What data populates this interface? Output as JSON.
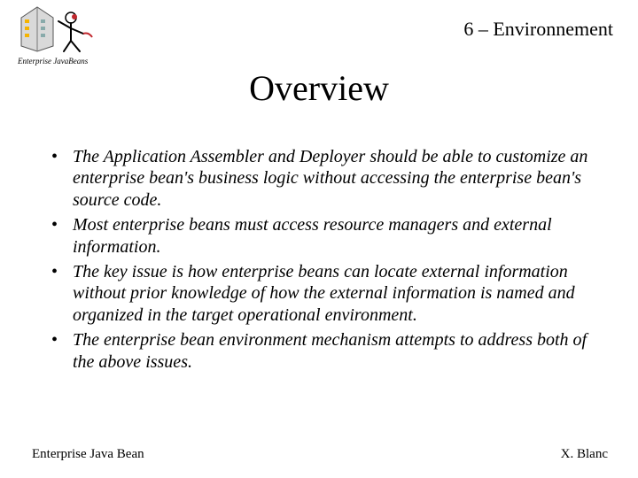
{
  "header": "6 – Environnement",
  "title": "Overview",
  "bullets": [
    "The Application Assembler and Deployer should be able to customize an enterprise bean's business logic without accessing the enterprise bean's source code.",
    "Most enterprise beans must access resource managers and external information.",
    "The key issue is how enterprise beans can locate external information without prior knowledge of how the external information is named and organized in the target operational environment.",
    "The enterprise bean environment mechanism attempts to address both of the above issues."
  ],
  "footer": {
    "left": "Enterprise Java Bean",
    "right": "X. Blanc"
  },
  "logo": {
    "caption": "Enterprise JavaBeans"
  }
}
